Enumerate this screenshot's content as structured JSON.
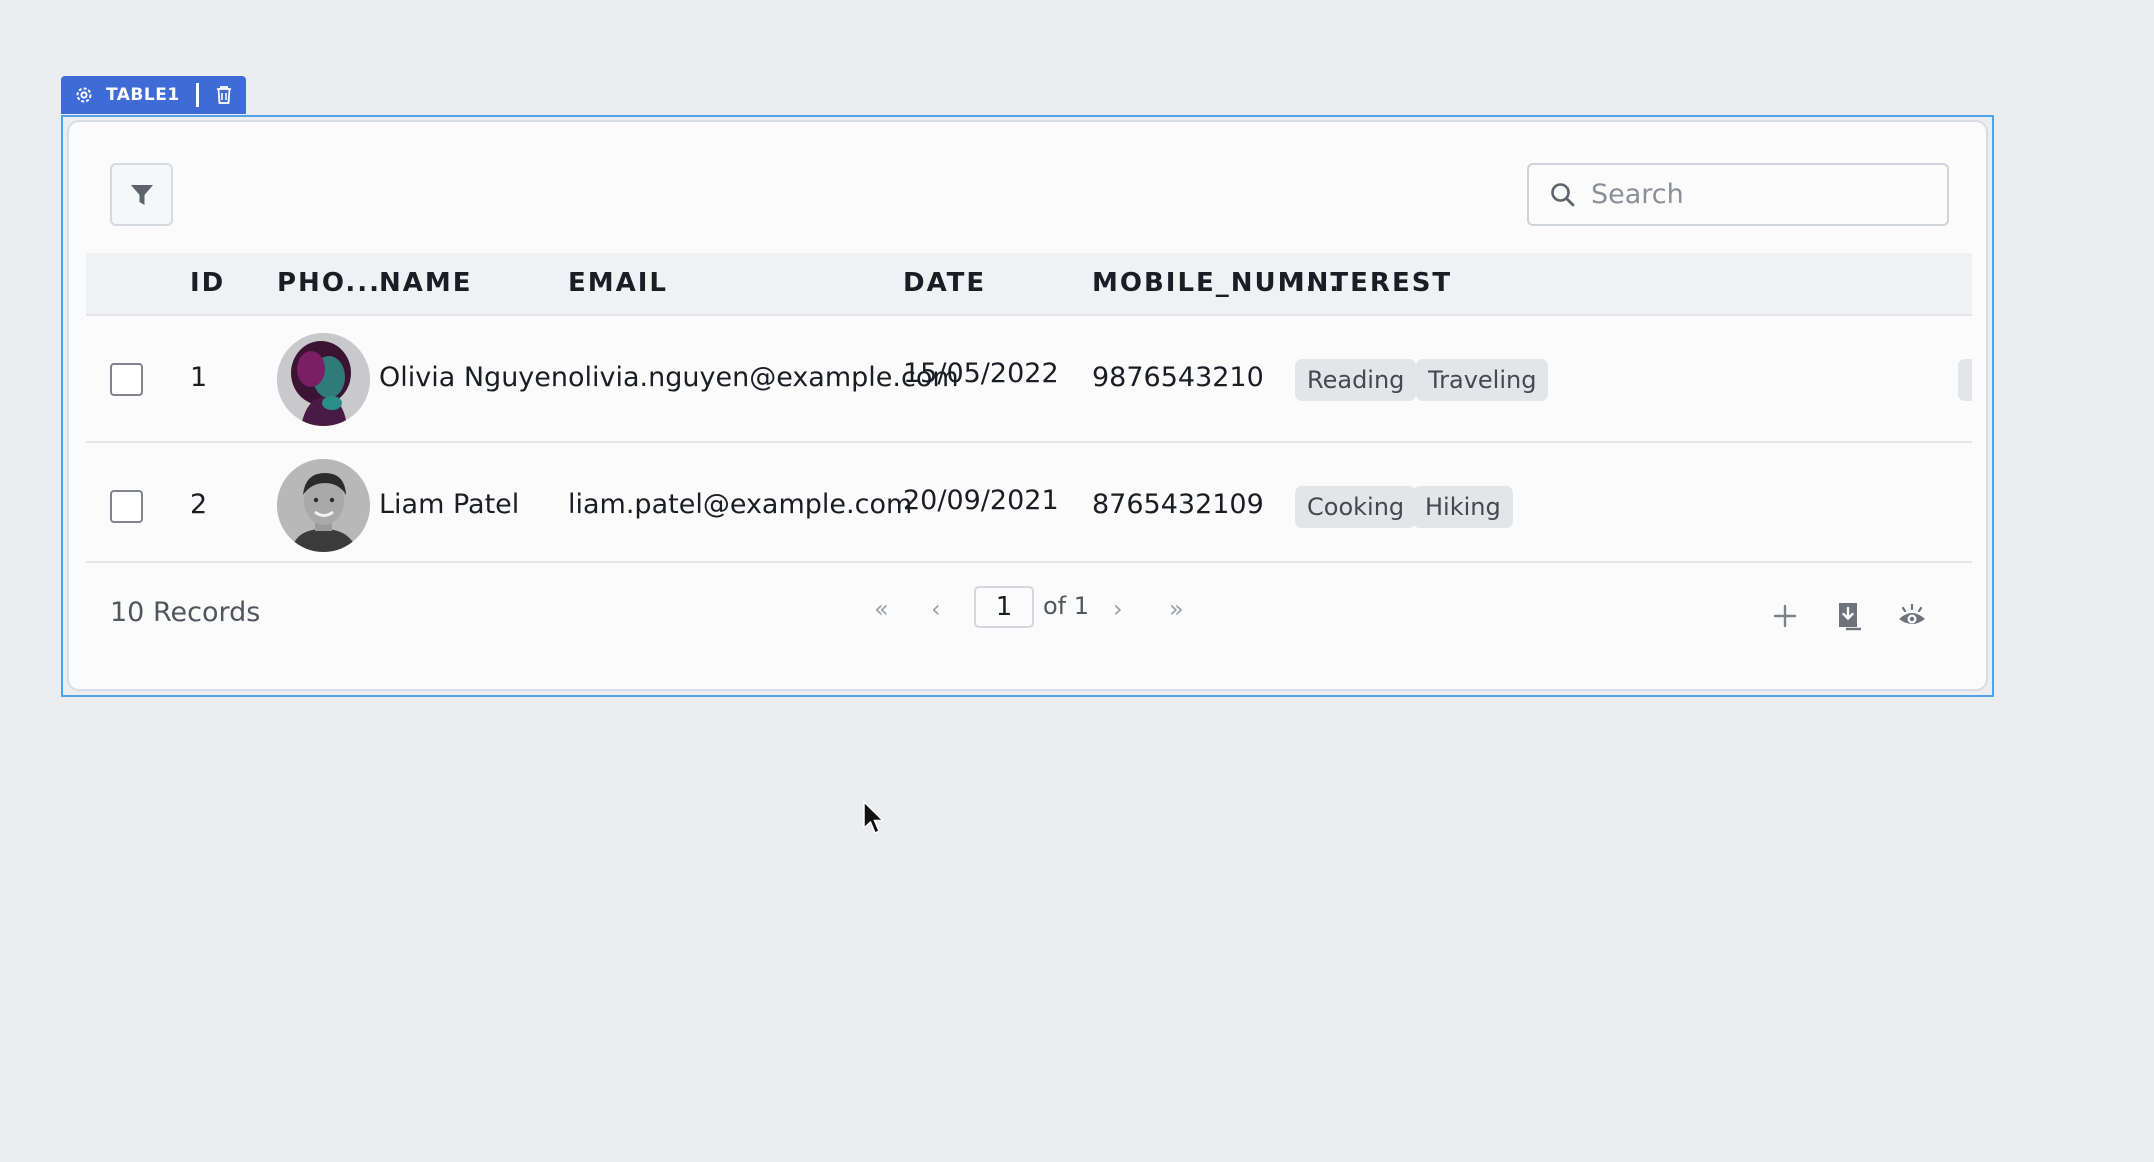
{
  "widget": {
    "name": "TABLE1"
  },
  "toolbar": {
    "search_placeholder": "Search"
  },
  "columns": [
    "ID",
    "PHO...",
    "NAME",
    "EMAIL",
    "DATE",
    "MOBILE_NUM...",
    "INTEREST"
  ],
  "rows": [
    {
      "id": "1",
      "name": "Olivia Nguyen",
      "email": "olivia.nguyen@example.com",
      "date": "15/05/2022",
      "mobile": "9876543210",
      "interests": [
        "Reading",
        "Traveling"
      ]
    },
    {
      "id": "2",
      "name": "Liam Patel",
      "email": "liam.patel@example.com",
      "date": "20/09/2021",
      "mobile": "8765432109",
      "interests": [
        "Cooking",
        "Hiking"
      ]
    }
  ],
  "footer": {
    "records": "10 Records",
    "current_page": "1",
    "page_total": "of 1"
  },
  "colors": {
    "accent": "#3f6bd6",
    "selection": "#4fa3e6"
  }
}
